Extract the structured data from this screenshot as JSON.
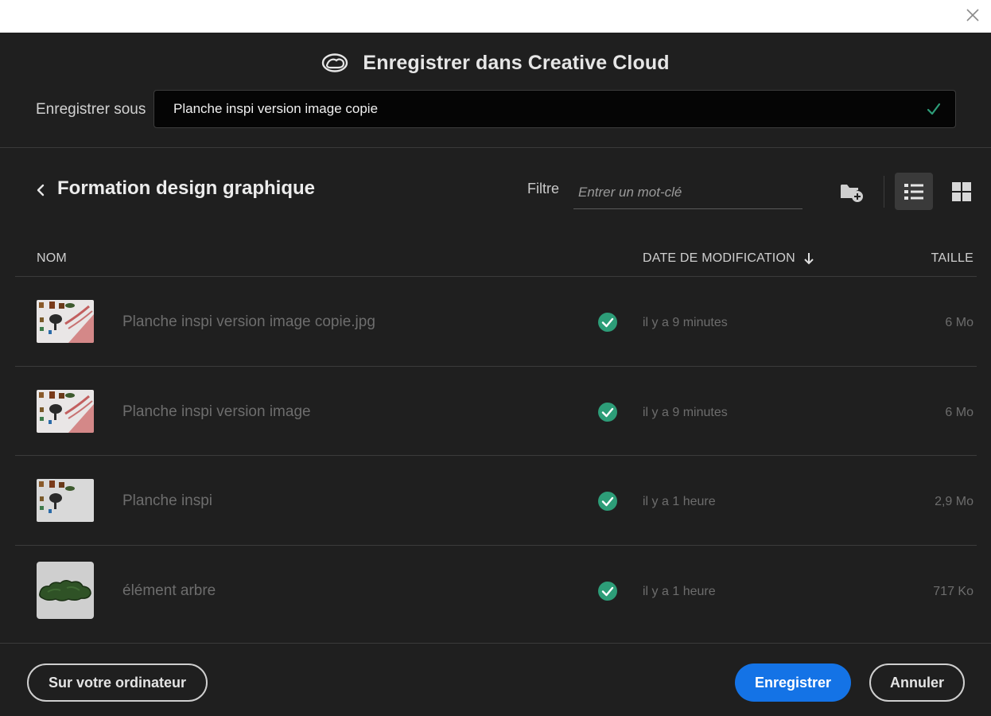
{
  "dialog": {
    "title": "Enregistrer dans Creative Cloud",
    "cc_logo_icon": "creative-cloud-icon",
    "close_icon": "close-icon"
  },
  "save_as": {
    "label": "Enregistrer sous",
    "value": "Planche inspi version image copie",
    "valid_icon": "checkmark-icon",
    "valid_color": "#2d9d78"
  },
  "browser": {
    "folder": "Formation design graphique",
    "back_icon": "chevron-left-icon",
    "filter_label": "Filtre",
    "filter_placeholder": "Entrer un mot-clé",
    "new_folder_icon": "new-folder-icon",
    "list_view_icon": "list-view-icon",
    "grid_view_icon": "grid-view-icon",
    "view_mode": "list"
  },
  "table": {
    "headers": {
      "name": "NOM",
      "date": "DATE DE MODIFICATION",
      "size": "TAILLE"
    },
    "sort_icon": "arrow-down-icon",
    "rows": [
      {
        "name": "Planche inspi version image copie.jpg",
        "date": "il y a 9 minutes",
        "size": "6 Mo",
        "thumb": "moodboard",
        "synced": true
      },
      {
        "name": "Planche inspi version image",
        "date": "il y a 9 minutes",
        "size": "6 Mo",
        "thumb": "moodboard",
        "synced": true
      },
      {
        "name": "Planche inspi",
        "date": "il y a 1 heure",
        "size": "2,9 Mo",
        "thumb": "moodboard-plain",
        "synced": true
      },
      {
        "name": "élément arbre",
        "date": "il y a 1 heure",
        "size": "717 Ko",
        "thumb": "tree",
        "synced": true
      }
    ]
  },
  "footer": {
    "local_button": "Sur votre ordinateur",
    "save_button": "Enregistrer",
    "cancel_button": "Annuler"
  },
  "colors": {
    "background": "#1f1f1f",
    "primary": "#1473e6",
    "sync_green": "#2d9d78"
  }
}
